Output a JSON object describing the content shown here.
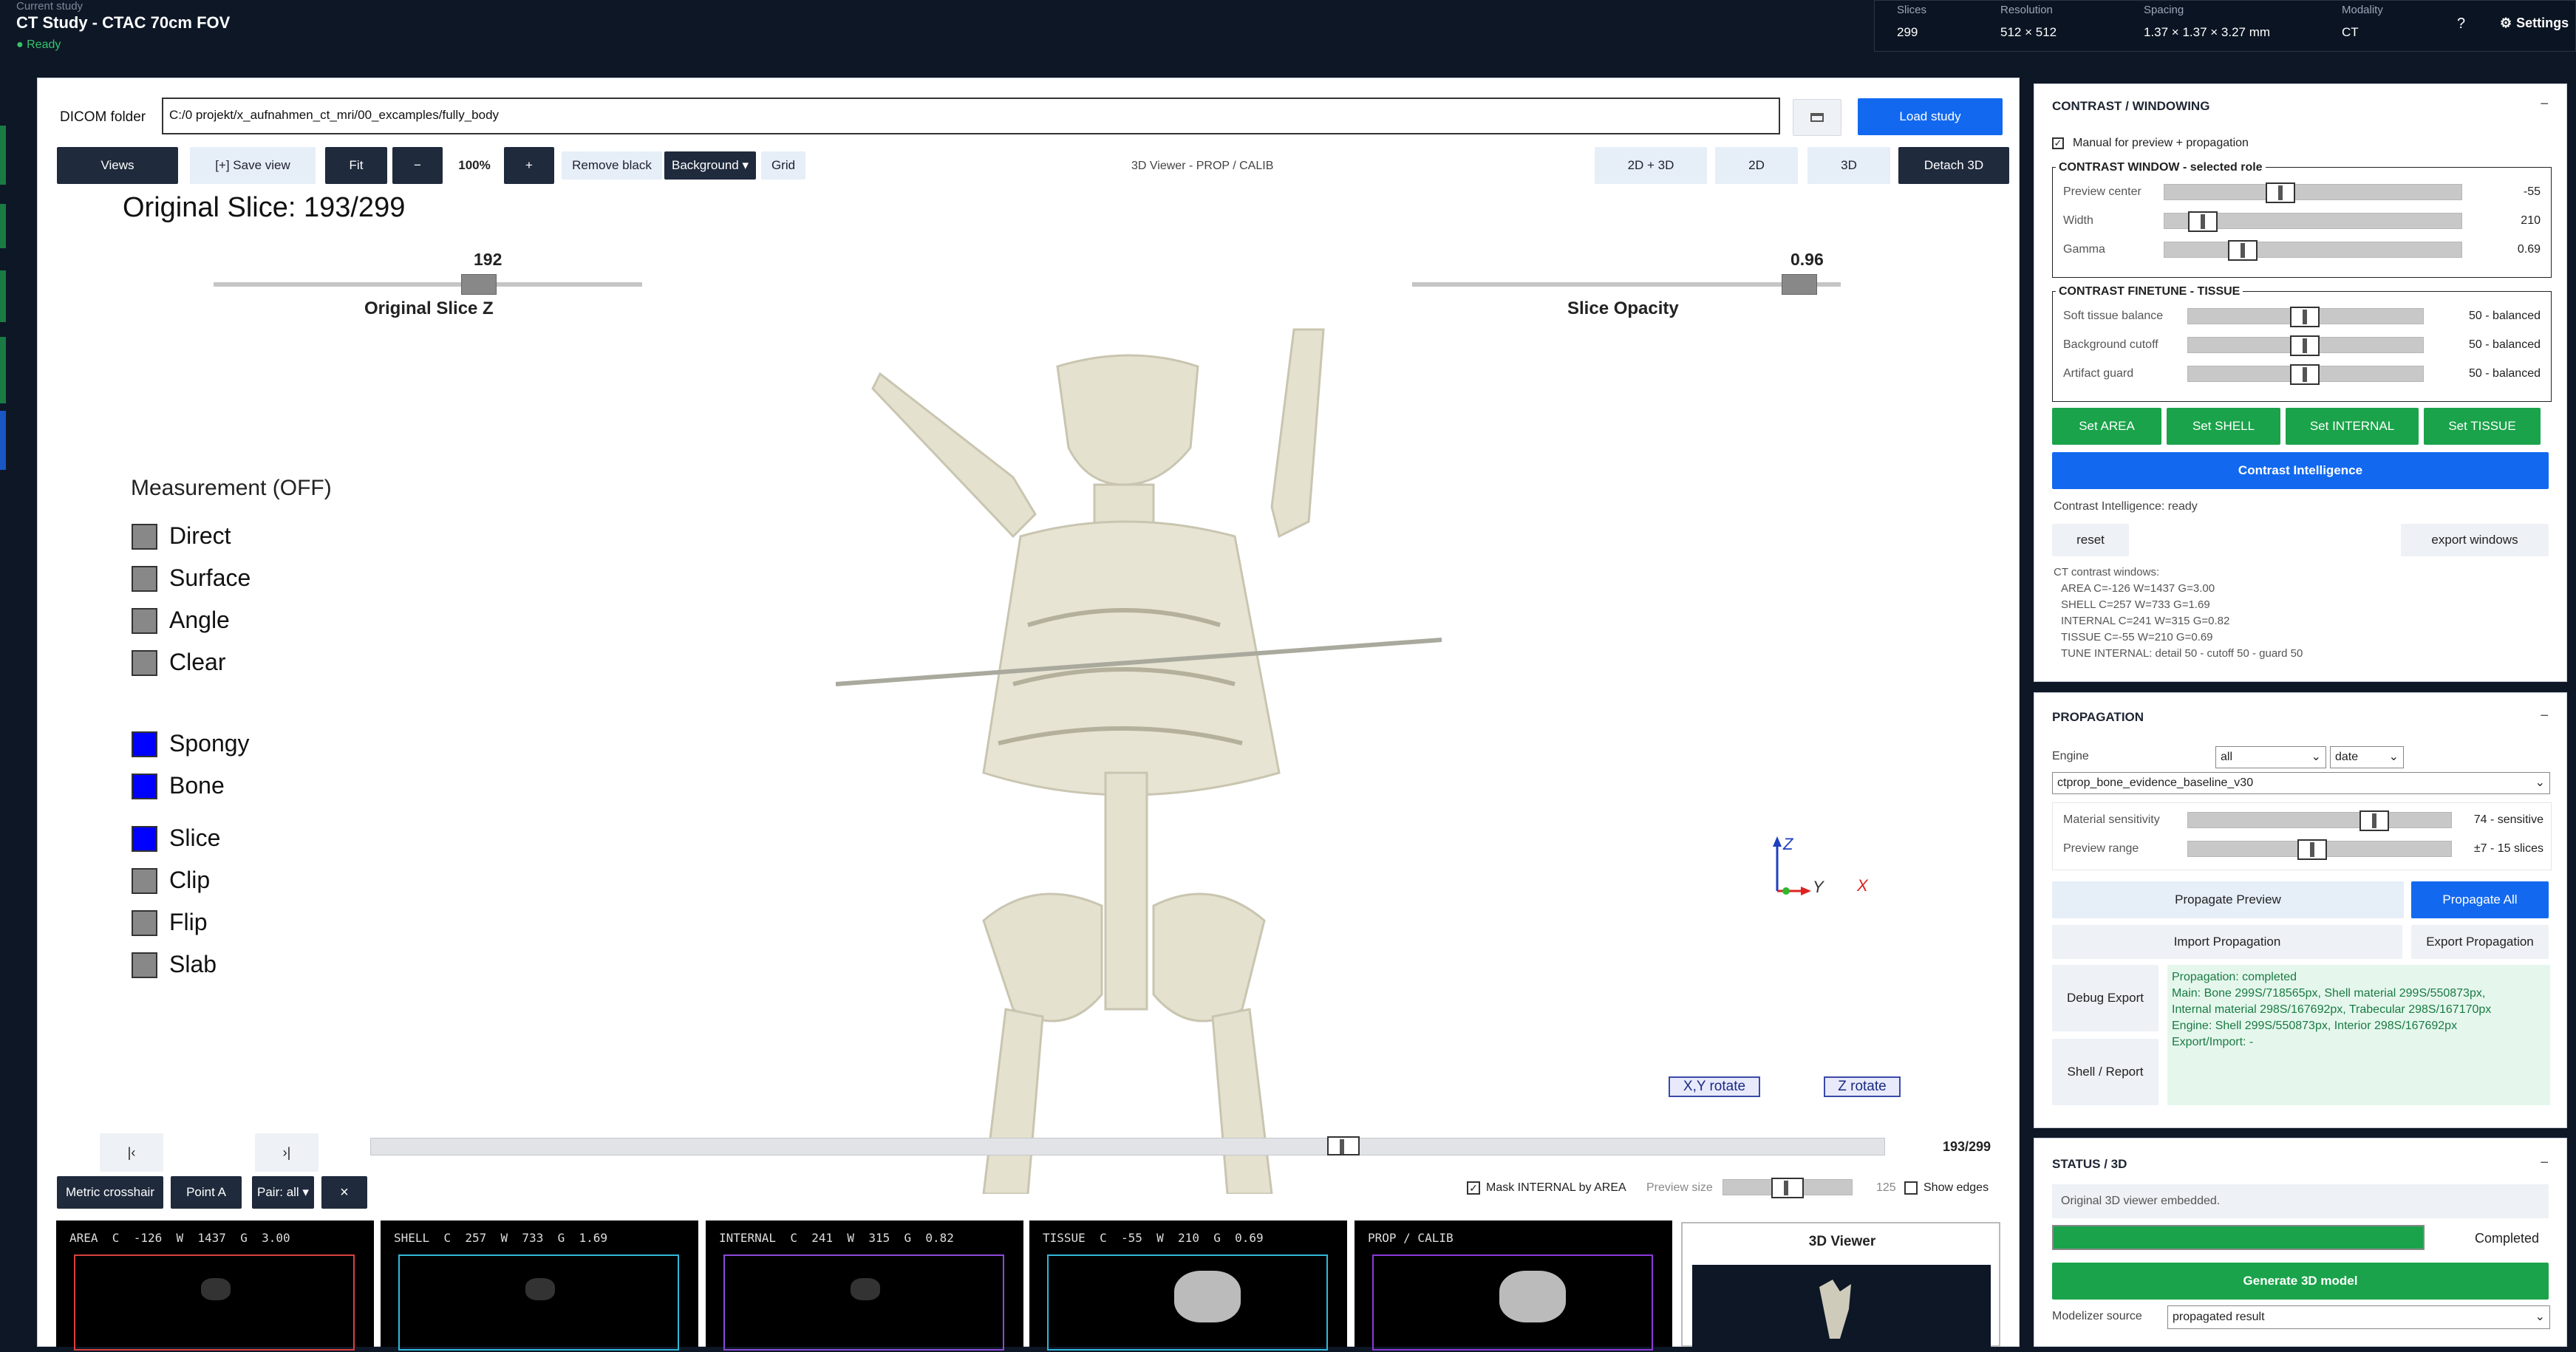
{
  "header": {
    "caption": "Current study",
    "study_title": "CT Study - CTAC 70cm FOV",
    "status": "● Ready",
    "info": [
      {
        "label": "Slices",
        "value": "299"
      },
      {
        "label": "Resolution",
        "value": "512 × 512"
      },
      {
        "label": "Spacing",
        "value": "1.37 × 1.37 × 3.27 mm"
      },
      {
        "label": "Modality",
        "value": "CT"
      }
    ],
    "help_label": "?",
    "settings_label": "Settings"
  },
  "dicom": {
    "label": "DICOM folder",
    "path": "C:/0 projekt/x_aufnahmen_ct_mri/00_excamples/fully_body",
    "load_label": "Load study"
  },
  "toolbar": {
    "views": "Views",
    "save_view": "[+] Save view",
    "fit": "Fit",
    "minus": "−",
    "zoom": "100%",
    "plus": "+",
    "remove_black": "Remove black",
    "background": "Background ▾",
    "grid": "Grid",
    "viewer_label": "3D Viewer - PROP / CALIB",
    "mode_2d3d": "2D + 3D",
    "mode_2d": "2D",
    "mode_3d": "3D",
    "detach": "Detach 3D"
  },
  "viewer": {
    "slice_title": "Original Slice: 193/299",
    "slice_z_value": "192",
    "slice_z_label": "Original Slice Z",
    "opacity_value": "0.96",
    "opacity_label": "Slice Opacity",
    "slice_z_fraction": 0.63,
    "opacity_fraction": 0.94,
    "measurement_title": "Measurement (OFF)",
    "measure_items": [
      {
        "label": "Direct",
        "color": "#888888"
      },
      {
        "label": "Surface",
        "color": "#888888"
      },
      {
        "label": "Angle",
        "color": "#888888"
      },
      {
        "label": "Clear",
        "color": "#888888"
      }
    ],
    "layer_items": [
      {
        "label": "Spongy",
        "color": "#0000ff"
      },
      {
        "label": "Bone",
        "color": "#0000ff"
      }
    ],
    "tool_items": [
      {
        "label": "Slice",
        "color": "#0000ff"
      },
      {
        "label": "Clip",
        "color": "#888888"
      },
      {
        "label": "Flip",
        "color": "#888888"
      },
      {
        "label": "Slab",
        "color": "#888888"
      }
    ],
    "axis_z": "Z",
    "axis_y": "Y",
    "axis_x": "X",
    "xy_rotate": "X,Y rotate",
    "z_rotate": "Z rotate"
  },
  "nav": {
    "first": "|‹",
    "last": "›|",
    "position": "193/299",
    "position_fraction": 0.645
  },
  "bottom_toolbar": {
    "metric_crosshair": "Metric crosshair",
    "point_a": "Point A",
    "pair": "Pair: all ▾",
    "close": "×",
    "mask_label": "Mask INTERNAL by AREA",
    "mask_checked": true,
    "preview_size_label": "Preview size",
    "preview_size_value": "125",
    "show_edges_label": "Show edges",
    "show_edges_checked": false
  },
  "thumbnails": [
    {
      "name": "AREA",
      "c": "-126",
      "w": "1437",
      "g": "3.00",
      "color": "#d94040"
    },
    {
      "name": "SHELL",
      "c": "257",
      "w": "733",
      "g": "1.69",
      "color": "#30b8d8"
    },
    {
      "name": "INTERNAL",
      "c": "241",
      "w": "315",
      "g": "0.82",
      "color": "#8a4ad8"
    },
    {
      "name": "TISSUE",
      "c": "-55",
      "w": "210",
      "g": "0.69",
      "color": "#30b8d8"
    },
    {
      "name": "PROP / CALIB",
      "color": "#8a3ad8"
    }
  ],
  "thumb_labels": {
    "c": "C",
    "w": "W",
    "g": "G"
  },
  "viewer3d_thumb": {
    "title": "3D Viewer"
  },
  "contrast": {
    "title": "CONTRAST / WINDOWING",
    "collapse": "−",
    "manual_label": "Manual for preview + propagation",
    "manual_checked": true,
    "window_group": "CONTRAST WINDOW - selected role",
    "window_sliders": [
      {
        "label": "Preview center",
        "value": "-55",
        "fraction": 0.38
      },
      {
        "label": "Width",
        "value": "210",
        "fraction": 0.09
      },
      {
        "label": "Gamma",
        "value": "0.69",
        "fraction": 0.24
      }
    ],
    "finetune_group": "CONTRAST FINETUNE - TISSUE",
    "finetune_sliders": [
      {
        "label": "Soft tissue balance",
        "value": "50 - balanced",
        "fraction": 0.5
      },
      {
        "label": "Background cutoff",
        "value": "50 - balanced",
        "fraction": 0.5
      },
      {
        "label": "Artifact guard",
        "value": "50 - balanced",
        "fraction": 0.5
      }
    ],
    "role_buttons": [
      "Set AREA",
      "Set SHELL",
      "Set INTERNAL",
      "Set TISSUE"
    ],
    "intelligence_button": "Contrast Intelligence",
    "intelligence_status": "Contrast Intelligence: ready",
    "reset": "reset",
    "export_windows": "export windows",
    "windows_heading": "CT contrast windows:",
    "windows_lines": [
      "AREA C=-126 W=1437 G=3.00",
      "SHELL C=257 W=733 G=1.69",
      "INTERNAL C=241 W=315 G=0.82",
      "TISSUE C=-55 W=210 G=0.69",
      "TUNE INTERNAL: detail 50 - cutoff 50 - guard 50"
    ]
  },
  "propagation": {
    "title": "PROPAGATION",
    "collapse": "−",
    "engine_label": "Engine",
    "engine_value": "all",
    "sort_value": "date",
    "profile_value": "ctprop_bone_evidence_baseline_v30",
    "sliders": [
      {
        "label": "Material sensitivity",
        "value": "74 - sensitive",
        "fraction": 0.74
      },
      {
        "label": "Preview range",
        "value": "±7 - 15 slices",
        "fraction": 0.47
      }
    ],
    "preview_button": "Propagate Preview",
    "all_button": "Propagate All",
    "import_button": "Import Propagation",
    "export_button": "Export Propagation",
    "debug_button": "Debug Export",
    "report_button": "Shell / Report",
    "log_lines": [
      "Propagation: completed",
      "Main: Bone 299S/718565px, Shell material 299S/550873px,",
      "Internal material 298S/167692px, Trabecular 298S/167170px",
      "Engine: Shell 299S/550873px, Interior 298S/167692px",
      "Export/Import: -"
    ]
  },
  "status3d": {
    "title": "STATUS / 3D",
    "collapse": "−",
    "message": "Original 3D viewer embedded.",
    "progress": 1.0,
    "progress_label": "Completed",
    "generate_button": "Generate 3D model",
    "source_label": "Modelizer source",
    "source_value": "propagated result"
  }
}
